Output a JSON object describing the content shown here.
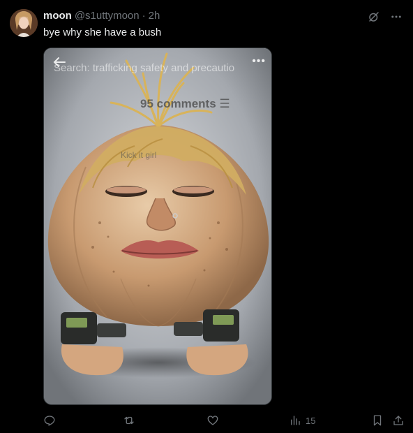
{
  "post": {
    "author_name": "moon",
    "author_handle": "@s1uttymoon",
    "separator": "·",
    "time": "2h",
    "text": "bye why she have a bush",
    "media": {
      "overlay_search": "Search: trafficking safety and precautio",
      "overlay_comments": "95 comments ☰",
      "overlay_kit": "Kick it girl"
    },
    "actions": {
      "views_count": "15"
    }
  },
  "icons": {
    "grok": "grok-icon",
    "more": "more-icon",
    "reply": "reply-icon",
    "retweet": "retweet-icon",
    "like": "heart-icon",
    "views": "views-icon",
    "bookmark": "bookmark-icon",
    "share": "share-icon"
  },
  "colors": {
    "background": "#000000",
    "text_primary": "#e7e9ea",
    "text_secondary": "#71767b"
  }
}
